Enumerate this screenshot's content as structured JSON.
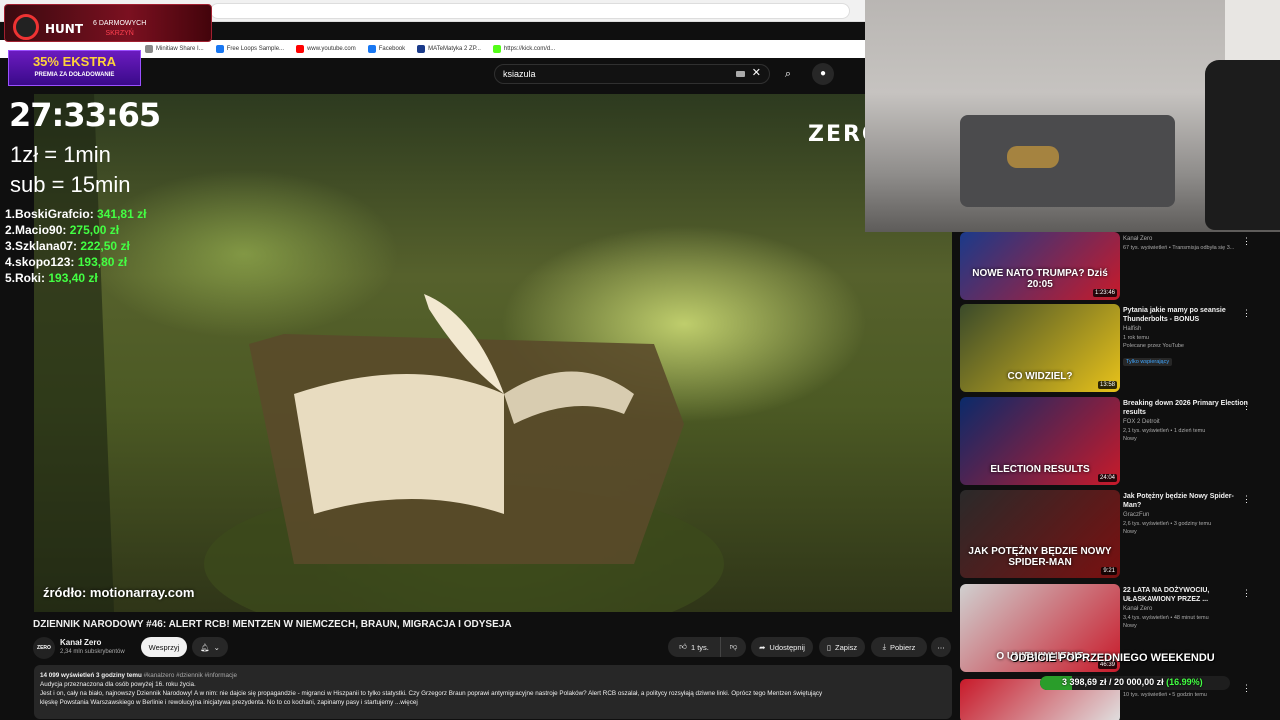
{
  "browser": {
    "bookmarks": [
      "Minitiaw Share I...",
      "Free Loops Sample...",
      "www.youtube.com",
      "Facebook",
      "MATeMatyka 2 ZP...",
      "https://kick.com/d..."
    ]
  },
  "search": {
    "query": "ksiazula"
  },
  "video": {
    "channel_watermark": "ZERO",
    "source_caption": "źródło: motionarray.com",
    "title": "DZIENNIK NARODOWY #46: ALERT RCB! MENTZEN W NIEMCZECH, BRAUN, MIGRACJA I ODYSEJA"
  },
  "channel": {
    "avatar_text": "ZERO",
    "name": "Kanał Zero",
    "subscribers": "2,34 mln subskrybentów",
    "support_label": "Wesprzyj"
  },
  "actions": {
    "likes": "1 tys.",
    "share": "Udostępnij",
    "save": "Zapisz",
    "download": "Pobierz",
    "more": "⋯"
  },
  "description": {
    "stats": "14 099 wyświetleń  3 godziny temu",
    "tags": "#kanalzero #dziennik #informacje",
    "line1": "Audycja przeznaczona dla osób powyżej 16. roku życia.",
    "line2": "Jest i on, cały na biało, najnowszy Dziennik Narodowy! A w nim: nie dajcie się propagandzie - migranci w Hiszpanii to tylko statystki. Czy Grzegorz Braun poprawi antymigracyjne nastroje Polaków? Alert RCB oszalał, a politycy rozsyłają dziwne linki. Oprócz tego Mentzen świętujący",
    "line3": "klęskę Powstania Warszawskiego w Berlinie i rewolucyjna inicjatywa prezydenta. No to co kochani, zapinamy pasy i startujemy",
    "more": "...więcej"
  },
  "overlay": {
    "hunt_title": "HUNT",
    "hunt_sub1": "6 DARMOWYCH",
    "hunt_sub2": "SKRZYŃ",
    "ekstra_big": "35% EKSTRA",
    "ekstra_small": "PREMIA ZA DOŁADOWANIE",
    "timer": "27:33:65",
    "rate1": "1zł = 1min",
    "rate2": "sub = 15min",
    "leaderboard": [
      {
        "rank": "1.",
        "name": "BoskiGrafcio:",
        "amount": "341,81 zł"
      },
      {
        "rank": "2.",
        "name": "Macio90:",
        "amount": "275,00 zł"
      },
      {
        "rank": "3.",
        "name": "Szklana07:",
        "amount": "222,50 zł"
      },
      {
        "rank": "4.",
        "name": "skopo123:",
        "amount": "193,80 zł"
      },
      {
        "rank": "5.",
        "name": "Roki:",
        "amount": "193,40 zł"
      }
    ],
    "weekend_title": "ODBICIE POPRZEDNIEGO WEEKENDU",
    "weekend_progress": "3 398,69 zł / 20 000,00 zł",
    "weekend_pct": "(16.99%)",
    "weekend_fraction": 0.1699
  },
  "sidebar": [
    {
      "title": "",
      "channel": "Kanał Zero",
      "stats": "67 tys. wyświetleń • Transmisja odbyła się 3...",
      "badge": "",
      "duration": "1:23:46",
      "thumb_text": "NOWE NATO TRUMPA? Dziś 20:05",
      "colors": [
        "#1a3a8a",
        "#c81a2a"
      ]
    },
    {
      "title": "Pytania jakie mamy po seansie Thunderbolts - BONUS",
      "channel": "Halfish",
      "stats": "1 rok temu",
      "badge": "Polecane przez YouTube",
      "badge2": "Tylko wspierający",
      "duration": "13:58",
      "thumb_text": "CO WIDZIEL?",
      "colors": [
        "#3a4a2a",
        "#e8c21a"
      ]
    },
    {
      "title": "Breaking down 2026 Primary Election results",
      "channel": "FOX 2 Detroit",
      "stats": "2,1 tys. wyświetleń • 1 dzień temu",
      "badge": "Nowy",
      "duration": "24:04",
      "thumb_text": "ELECTION RESULTS",
      "colors": [
        "#0a2a6a",
        "#c81a2a"
      ]
    },
    {
      "title": "Jak Potężny będzie Nowy Spider-Man?",
      "channel": "GraczFun",
      "stats": "2,6 tys. wyświetleń • 3 godziny temu",
      "badge": "Nowy",
      "duration": "9:21",
      "thumb_text": "JAK POTĘŻNY BĘDZIE NOWY SPIDER-MAN",
      "colors": [
        "#2a2a2a",
        "#7a1010"
      ]
    },
    {
      "title": "22 LATA NA DOŻYWOCIU, UŁASKAWIONY PRZEZ ...",
      "channel": "Kanał Zero",
      "stats": "3,4 tys. wyświetleń • 48 minut temu",
      "badge": "Nowy",
      "duration": "46:39",
      "thumb_text": "O UNIEWINNIENIE",
      "colors": [
        "#d0d0d0",
        "#c81a2a"
      ]
    },
    {
      "title": "",
      "channel": "MMA-będź na bieżąco",
      "stats": "10 tys. wyświetleń • 5 godzin temu",
      "badge": "",
      "duration": "",
      "thumb_text": "",
      "colors": [
        "#c81a2a",
        "#e0e0e0"
      ]
    }
  ]
}
